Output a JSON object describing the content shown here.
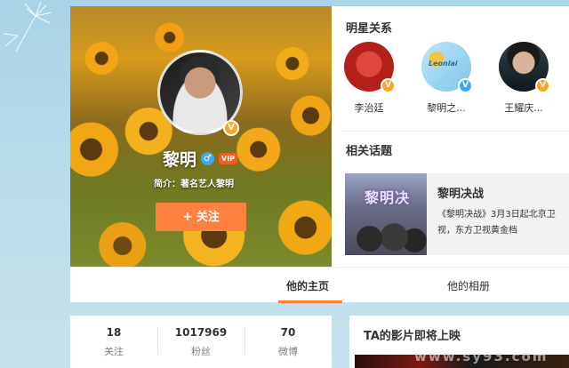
{
  "profile": {
    "name": "黎明",
    "intro": "简介：著名艺人黎明",
    "follow_label": "关注",
    "gender_icon": "male-icon",
    "verified_badge": "V",
    "vip_badge": "VIP"
  },
  "relations": {
    "title": "明星关系",
    "items": [
      {
        "name": "李治廷",
        "badge": "V",
        "badge_color": "#f6a623",
        "avatar_color": "#c9261c"
      },
      {
        "name": "黎明之...",
        "badge": "V",
        "badge_color": "#3aa9f0",
        "avatar_color": "#8fd3f0",
        "logo_text": "Leonlai"
      },
      {
        "name": "王耀庆...",
        "badge": "V",
        "badge_color": "#f6a623",
        "avatar_color": "#1e2a33"
      }
    ]
  },
  "topics": {
    "title": "相关话题",
    "card": {
      "title": "黎明决战",
      "description": "《黎明决战》3月3日起北京卫视，东方卫视黄金档",
      "image_text": "黎明决"
    }
  },
  "tabs": [
    {
      "label": "他的主页",
      "active": true
    },
    {
      "label": "他的相册",
      "active": false
    }
  ],
  "stats": [
    {
      "value": "18",
      "label": "关注"
    },
    {
      "value": "1017969",
      "label": "粉丝"
    },
    {
      "value": "70",
      "label": "微博"
    }
  ],
  "films": {
    "title": "TA的影片即将上映"
  },
  "watermark": "www.sy93.com",
  "colors": {
    "accent": "#ff8140",
    "verified_orange": "#f6a623",
    "verified_blue": "#3aa9f0"
  }
}
